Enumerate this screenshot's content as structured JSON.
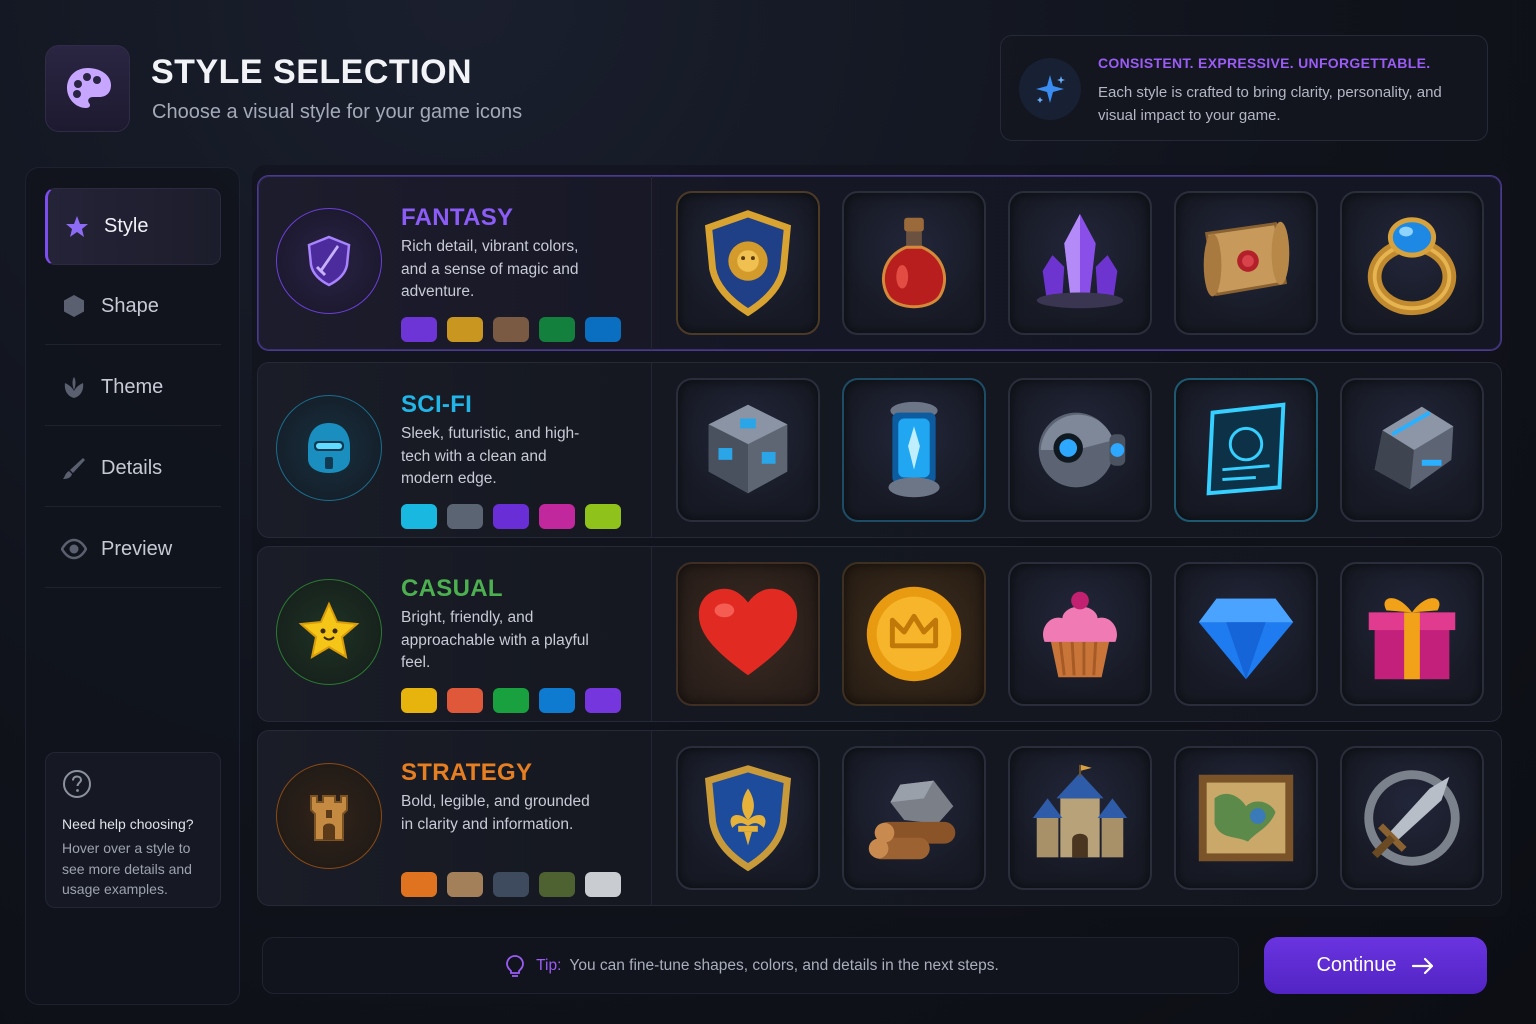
{
  "header": {
    "title": "STYLE SELECTION",
    "subtitle": "Choose a visual style for your game icons",
    "icon": "palette-icon"
  },
  "promo": {
    "tagline": "CONSISTENT. EXPRESSIVE. UNFORGETTABLE.",
    "text": "Each style is crafted to bring clarity, personality, and visual impact to your game.",
    "icon": "sparkle-icon"
  },
  "sidebar": {
    "items": [
      {
        "label": "Style",
        "icon": "star-icon",
        "active": true
      },
      {
        "label": "Shape",
        "icon": "hexagon-icon",
        "active": false
      },
      {
        "label": "Theme",
        "icon": "leaf-icon",
        "active": false
      },
      {
        "label": "Details",
        "icon": "brush-icon",
        "active": false
      },
      {
        "label": "Preview",
        "icon": "eye-icon",
        "active": false
      }
    ],
    "help": {
      "title": "Need help choosing?",
      "text": "Hover over a style to see more details and usage examples.",
      "icon": "question-icon"
    }
  },
  "styles": [
    {
      "name": "FANTASY",
      "description": "Rich detail, vibrant colors, and a sense of magic and adventure.",
      "accent": "#8b5cf6",
      "selected": true,
      "emblem": "shield-sword-icon",
      "swatches": [
        "#6d35d6",
        "#c9961f",
        "#7a5a43",
        "#13803e",
        "#0a6fc0"
      ],
      "icons": [
        "lion-shield-icon",
        "potion-icon",
        "crystal-icon",
        "scroll-icon",
        "ring-icon"
      ]
    },
    {
      "name": "SCI-FI",
      "description": "Sleek, futuristic, and high-tech with a clean and modern edge.",
      "accent": "#22b5e8",
      "selected": false,
      "emblem": "robot-helmet-icon",
      "swatches": [
        "#19b8e0",
        "#5a6472",
        "#6a2ed6",
        "#c2289e",
        "#8fc31c"
      ],
      "icons": [
        "tech-cube-icon",
        "energy-canister-icon",
        "drone-orb-icon",
        "holo-card-icon",
        "tech-module-icon"
      ]
    },
    {
      "name": "CASUAL",
      "description": "Bright, friendly, and approachable with a playful feel.",
      "accent": "#4caf50",
      "selected": false,
      "emblem": "smiling-star-icon",
      "swatches": [
        "#e7b30d",
        "#e0583a",
        "#18a13e",
        "#0e7bd1",
        "#7636de"
      ],
      "icons": [
        "heart-icon",
        "crown-coin-icon",
        "cupcake-icon",
        "gem-icon",
        "gift-icon"
      ]
    },
    {
      "name": "STRATEGY",
      "description": "Bold, legible, and grounded in clarity and information.",
      "accent": "#e67e22",
      "selected": false,
      "emblem": "castle-tower-icon",
      "swatches": [
        "#e0731f",
        "#a4805a",
        "#3e4a5e",
        "#4e6130",
        "#c9ccd1"
      ],
      "icons": [
        "fleur-shield-icon",
        "stone-wood-icon",
        "castle-icon",
        "map-icon",
        "crossed-sword-icon"
      ]
    }
  ],
  "footer": {
    "tip_label": "Tip:",
    "tip_text": "You can fine-tune shapes, colors, and details in the next steps.",
    "tip_icon": "lightbulb-icon",
    "continue_label": "Continue"
  }
}
